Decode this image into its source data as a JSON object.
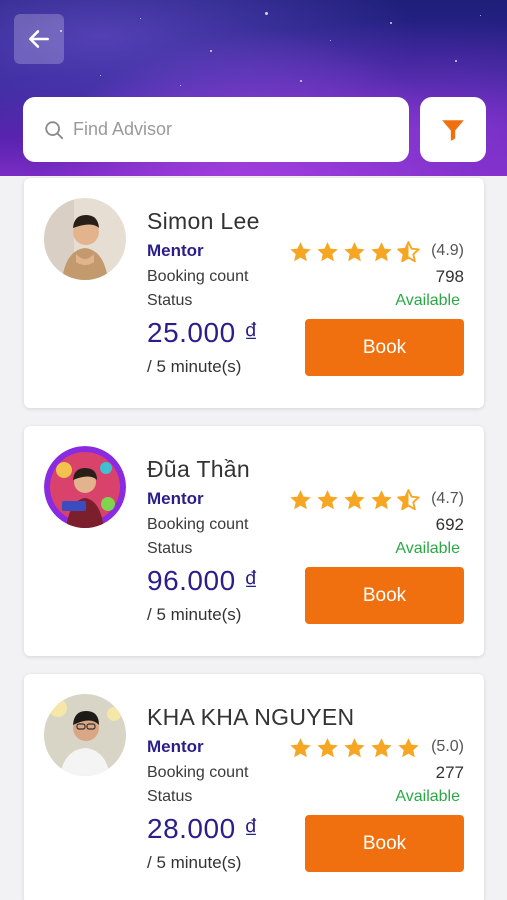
{
  "search": {
    "placeholder": "Find Advisor"
  },
  "colors": {
    "accent": "#f07010",
    "primary_text": "#2a1f8a",
    "status_available": "#2aa845",
    "star": "#f6a623"
  },
  "icons": {
    "back": "arrow-left-icon",
    "search": "search-icon",
    "filter": "filter-icon",
    "star": "star-icon"
  },
  "labels": {
    "booking_count": "Booking count",
    "status": "Status",
    "per_unit": "/ 5 minute(s)",
    "book": "Book"
  },
  "advisors": [
    {
      "name": "Simon Lee",
      "role": "Mentor",
      "rating": "(4.9)",
      "rating_value": 4.9,
      "booking_count": "798",
      "status": "Available",
      "price": "25.000 ₫"
    },
    {
      "name": "Đũa Thần",
      "role": "Mentor",
      "rating": "(4.7)",
      "rating_value": 4.7,
      "booking_count": "692",
      "status": "Available",
      "price": "96.000 ₫"
    },
    {
      "name": "KHA KHA NGUYEN",
      "role": "Mentor",
      "rating": "(5.0)",
      "rating_value": 5.0,
      "booking_count": "277",
      "status": "Available",
      "price": "28.000 ₫"
    }
  ]
}
